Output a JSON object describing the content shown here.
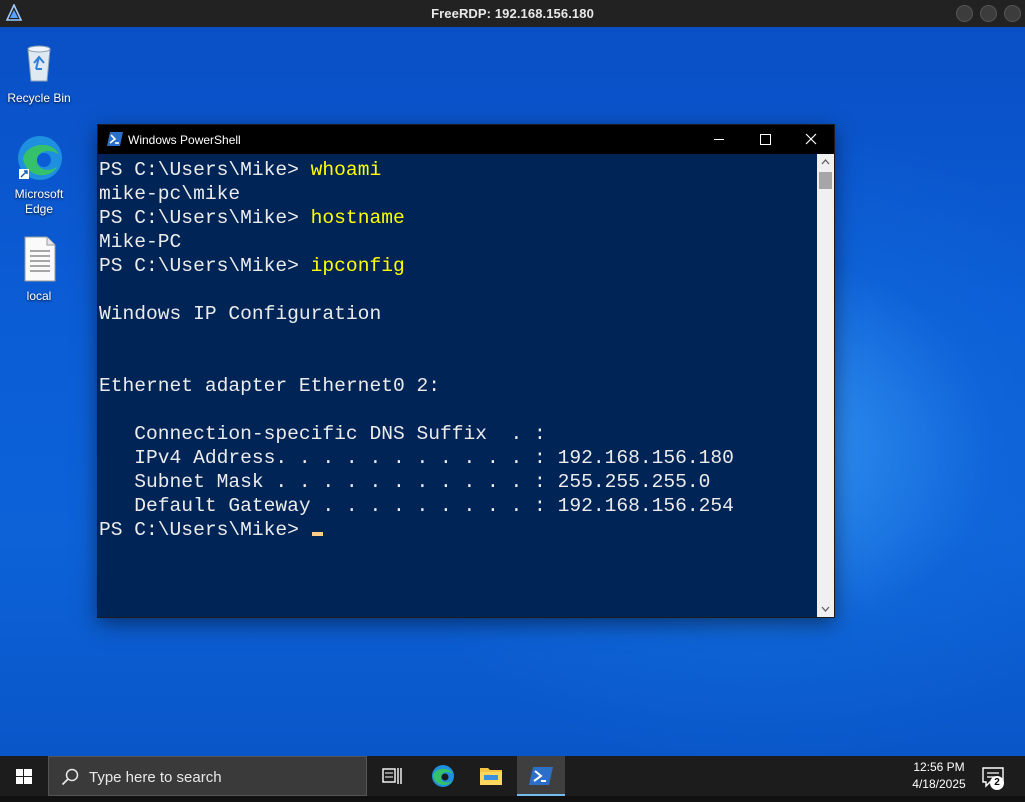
{
  "rdp": {
    "title": "FreeRDP: 192.168.156.180"
  },
  "desktop": {
    "icons": [
      {
        "label": "Recycle Bin"
      },
      {
        "label": "Microsoft Edge"
      },
      {
        "label": "local"
      }
    ]
  },
  "powershell": {
    "title": "Windows PowerShell",
    "lines": [
      {
        "prompt": "PS C:\\Users\\Mike> ",
        "cmd": "whoami"
      },
      {
        "text": "mike-pc\\mike"
      },
      {
        "prompt": "PS C:\\Users\\Mike> ",
        "cmd": "hostname"
      },
      {
        "text": "Mike-PC"
      },
      {
        "prompt": "PS C:\\Users\\Mike> ",
        "cmd": "ipconfig"
      },
      {
        "text": ""
      },
      {
        "text": "Windows IP Configuration"
      },
      {
        "text": ""
      },
      {
        "text": ""
      },
      {
        "text": "Ethernet adapter Ethernet0 2:"
      },
      {
        "text": ""
      },
      {
        "text": "   Connection-specific DNS Suffix  . :"
      },
      {
        "text": "   IPv4 Address. . . . . . . . . . . : 192.168.156.180"
      },
      {
        "text": "   Subnet Mask . . . . . . . . . . . : 255.255.255.0"
      },
      {
        "text": "   Default Gateway . . . . . . . . . : 192.168.156.254"
      },
      {
        "prompt": "PS C:\\Users\\Mike> ",
        "cmd": "",
        "cursor": true
      }
    ]
  },
  "taskbar": {
    "search_placeholder": "Type here to search",
    "time": "12:56 PM",
    "date": "4/18/2025",
    "notification_count": "2"
  },
  "colors": {
    "ps_background": "#012456",
    "ps_command": "#ffff00",
    "ps_text": "#ececec"
  }
}
